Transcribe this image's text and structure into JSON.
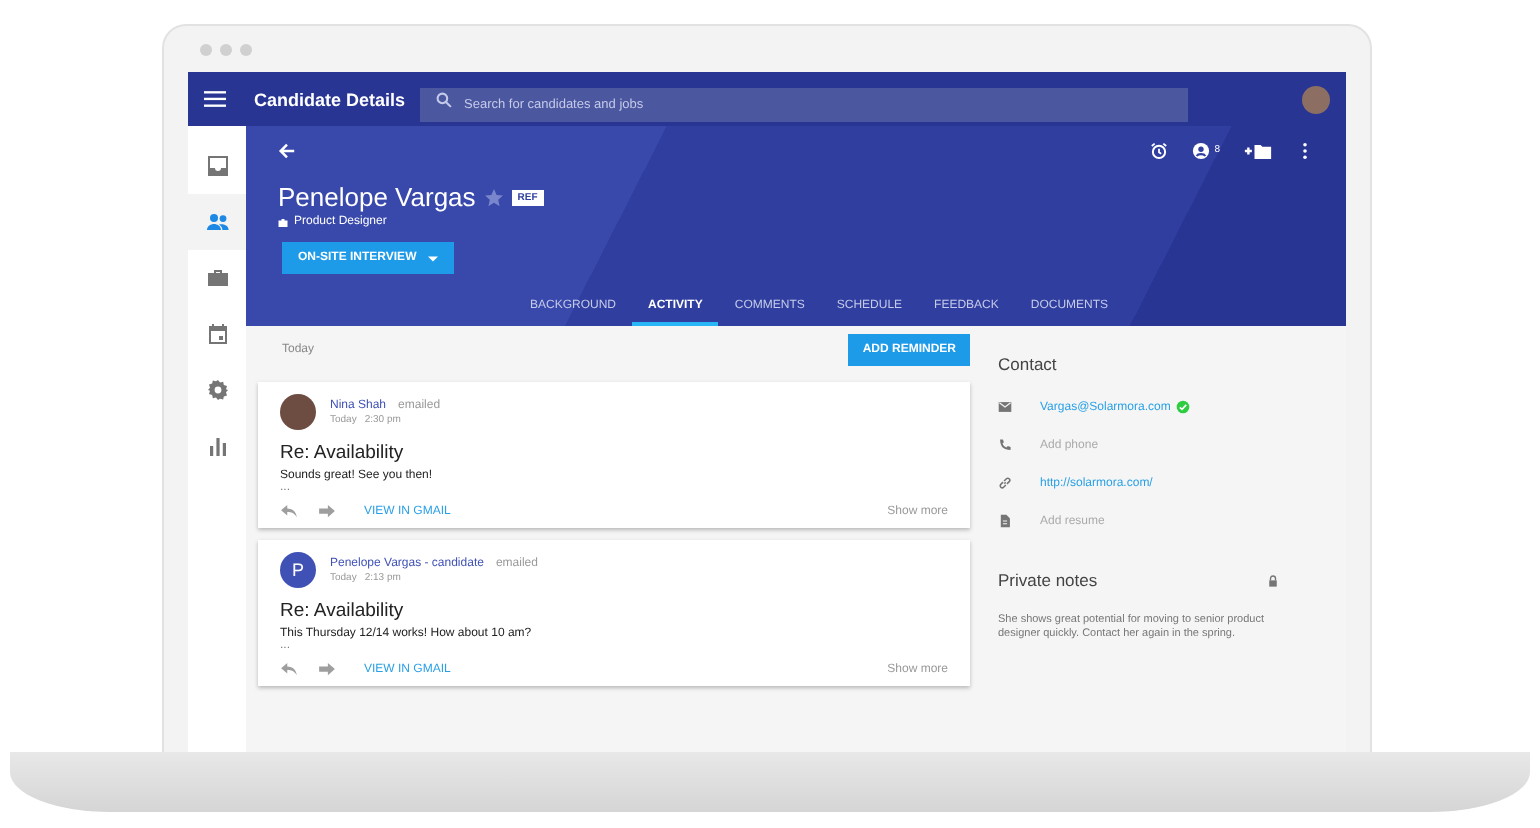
{
  "window": {
    "title": "Candidate Details"
  },
  "search": {
    "placeholder": "Search for candidates and jobs"
  },
  "sidebar": {
    "items": [
      {
        "kind": "inbox",
        "selected": false
      },
      {
        "kind": "people",
        "selected": true
      },
      {
        "kind": "briefcase",
        "selected": false
      },
      {
        "kind": "calendar",
        "selected": false
      },
      {
        "kind": "settings",
        "selected": false
      },
      {
        "kind": "chart",
        "selected": false
      }
    ]
  },
  "header": {
    "name": "Penelope Vargas",
    "starred": false,
    "badge": "REF",
    "role": "Product Designer",
    "stage_button": "ON-SITE INTERVIEW",
    "watchers_count": "8"
  },
  "tabs": [
    {
      "label": "BACKGROUND",
      "selected": false
    },
    {
      "label": "ACTIVITY",
      "selected": true
    },
    {
      "label": "COMMENTS",
      "selected": false
    },
    {
      "label": "SCHEDULE",
      "selected": false
    },
    {
      "label": "FEEDBACK",
      "selected": false
    },
    {
      "label": "DOCUMENTS",
      "selected": false
    }
  ],
  "activity": {
    "day": "Today",
    "add_button": "ADD REMINDER",
    "items": [
      {
        "kind": "photo",
        "author": "Nina Shah",
        "action": "emailed",
        "date": "Today",
        "time": "2:30 pm",
        "subject": "Re: Availability",
        "body": "Sounds great! See you then!",
        "more": "...",
        "link": "VIEW IN GMAIL",
        "show_more": "Show more"
      },
      {
        "kind": "initial",
        "initial": "P",
        "author": "Penelope Vargas - candidate",
        "action": "emailed",
        "date": "Today",
        "time": "2:13 pm",
        "subject": "Re: Availability",
        "body": "This Thursday 12/14 works! How about 10 am?",
        "more": "...",
        "link": "VIEW IN GMAIL",
        "show_more": "Show more"
      }
    ]
  },
  "contact": {
    "title": "Contact",
    "items": [
      {
        "kind": "email",
        "text": "Vargas@Solarmora.com",
        "linked": true,
        "verified": true
      },
      {
        "kind": "phone",
        "text": "Add phone",
        "linked": false,
        "verified": false
      },
      {
        "kind": "link",
        "text": "http://solarmora.com/",
        "linked": true,
        "verified": false
      },
      {
        "kind": "resume",
        "text": "Add resume",
        "linked": false,
        "verified": false
      }
    ]
  },
  "notes": {
    "title": "Private notes",
    "locked": true,
    "text": "She shows great potential for moving to senior product designer quickly. Contact her again in the spring."
  }
}
